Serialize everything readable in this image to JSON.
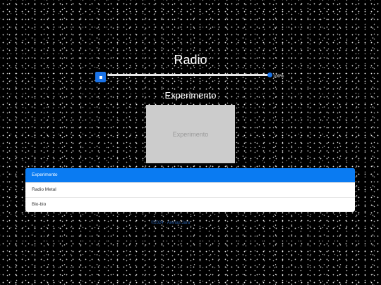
{
  "header": {
    "title": "Radio"
  },
  "player": {
    "stop_label": "■",
    "volume_percent": 100,
    "volume_label": "100%"
  },
  "now_playing": {
    "station": "Experimento",
    "artwork_text": "Experimento"
  },
  "stations": [
    {
      "label": "Experimento",
      "active": true
    },
    {
      "label": "Radio Metal",
      "active": false
    },
    {
      "label": "Bio-bio",
      "active": false
    }
  ],
  "footer": {
    "text": "©2024 · Arenas Jara"
  },
  "colors": {
    "accent": "#1a73e8",
    "active_row": "#0a7bf2",
    "background": "#000000",
    "artwork_bg": "#cccccc"
  }
}
